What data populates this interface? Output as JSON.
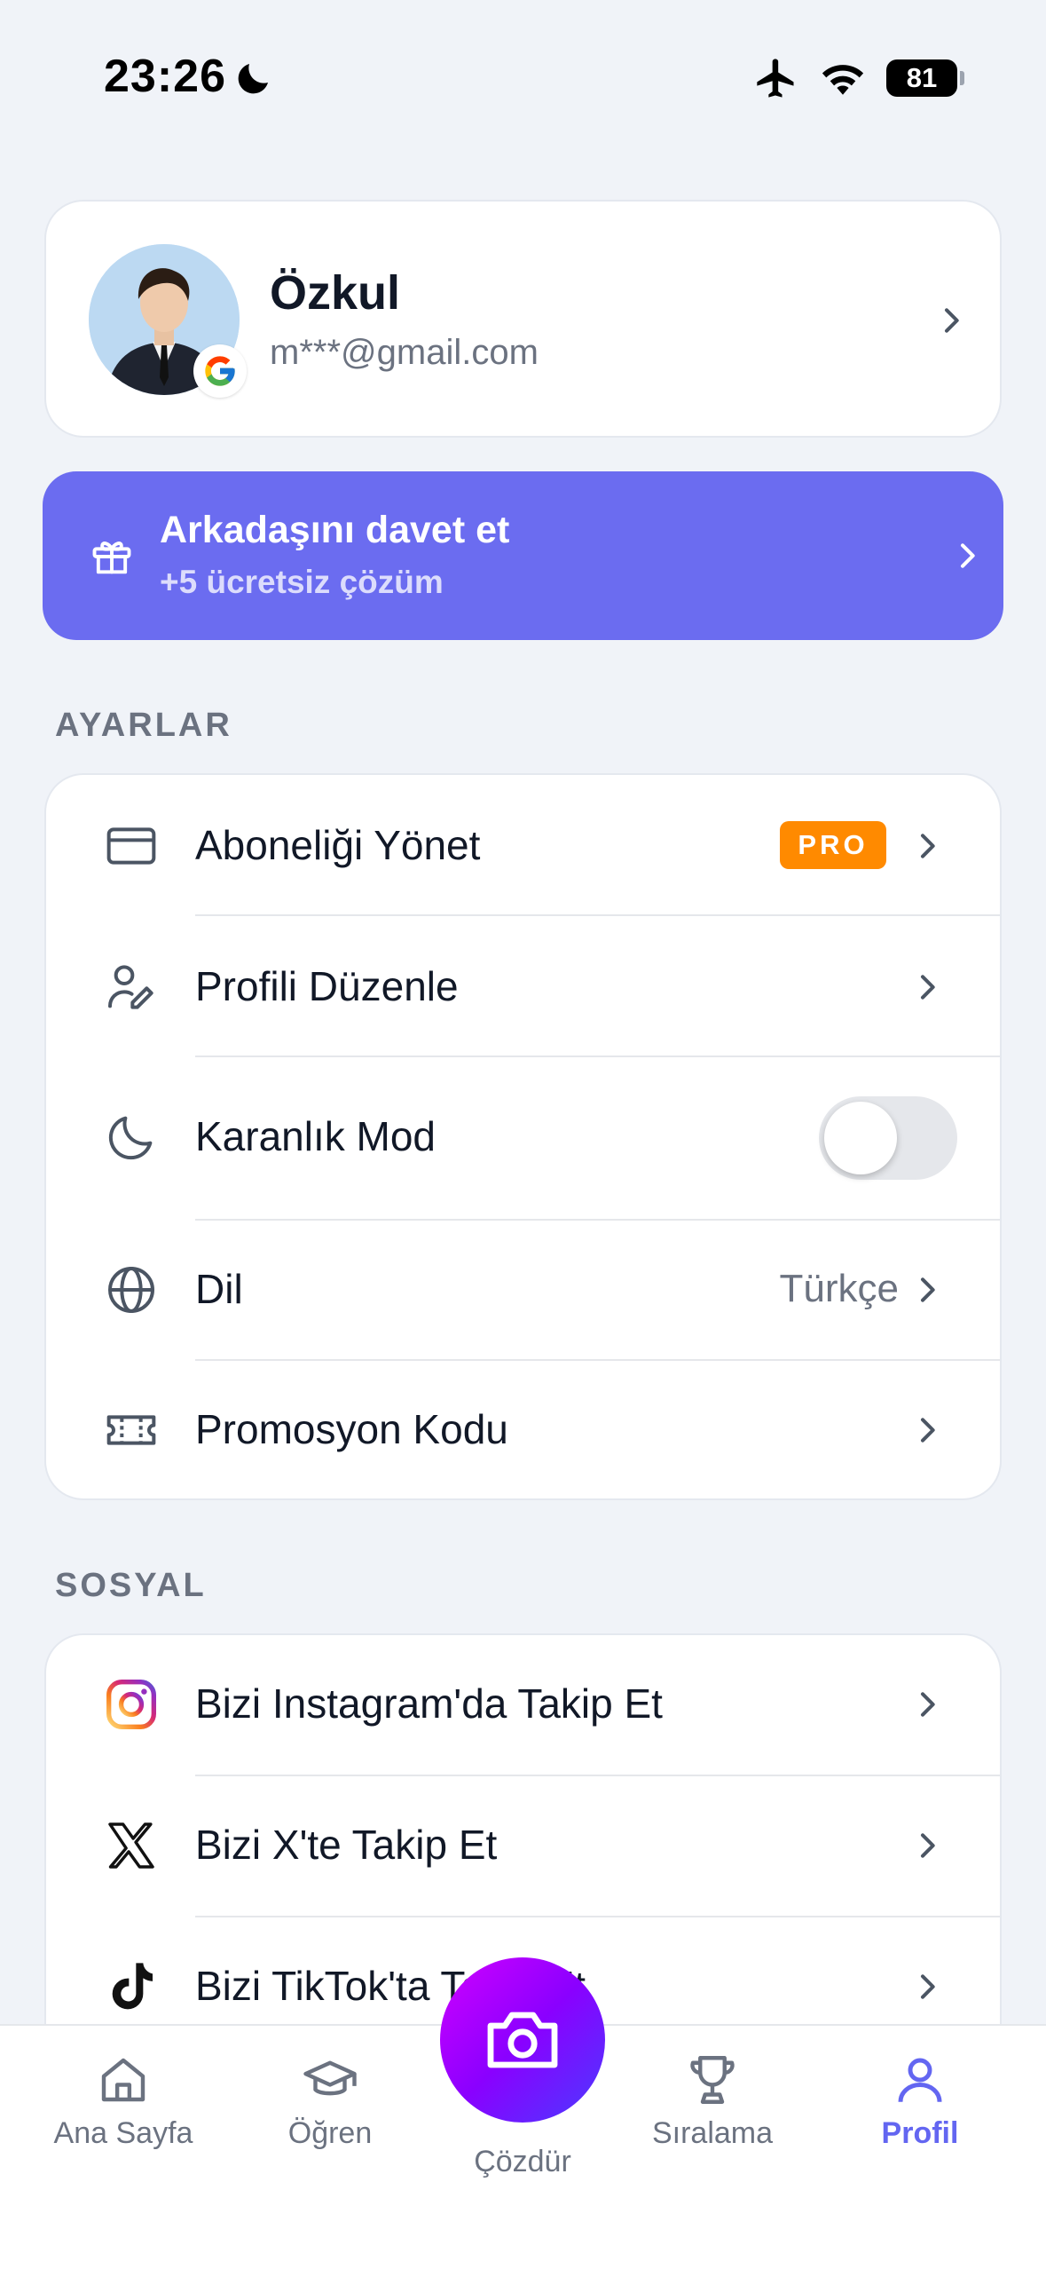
{
  "status_bar": {
    "time": "23:26",
    "battery": "81",
    "icons": [
      "moon-icon",
      "airplane-icon",
      "wifi-icon",
      "battery-icon"
    ]
  },
  "profile": {
    "name": "Özkul",
    "email": "m***@gmail.com",
    "provider_icon": "google-icon"
  },
  "invite": {
    "title": "Arkadaşını davet et",
    "subtitle": "+5 ücretsiz çözüm",
    "icon": "gift-icon",
    "color": "#6b6cf0"
  },
  "settings": {
    "section_title": "AYARLAR",
    "items": [
      {
        "label": "Aboneliği Yönet",
        "icon": "credit-card-icon",
        "badge": "PRO"
      },
      {
        "label": "Profili Düzenle",
        "icon": "user-edit-icon"
      },
      {
        "label": "Karanlık Mod",
        "icon": "moon-icon",
        "toggle": false
      },
      {
        "label": "Dil",
        "icon": "globe-icon",
        "value": "Türkçe"
      },
      {
        "label": "Promosyon Kodu",
        "icon": "ticket-icon"
      }
    ]
  },
  "social": {
    "section_title": "SOSYAL",
    "items": [
      {
        "label": "Bizi Instagram'da Takip Et",
        "icon": "instagram-icon"
      },
      {
        "label": "Bizi X'te Takip Et",
        "icon": "x-icon"
      },
      {
        "label": "Bizi TikTok'ta Takip Et",
        "icon": "tiktok-icon"
      }
    ]
  },
  "tab_bar": {
    "tabs": [
      {
        "label": "Ana Sayfa",
        "icon": "home-icon"
      },
      {
        "label": "Öğren",
        "icon": "graduation-cap-icon"
      },
      {
        "label": "Çözdür",
        "icon": "camera-icon"
      },
      {
        "label": "Sıralama",
        "icon": "trophy-icon"
      },
      {
        "label": "Profil",
        "icon": "user-icon"
      }
    ],
    "active": "Profil",
    "active_color": "#6366f1"
  }
}
